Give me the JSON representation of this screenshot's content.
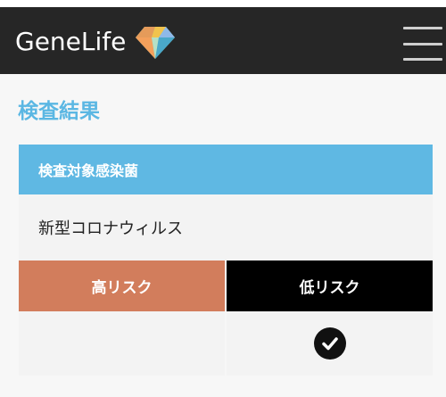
{
  "header": {
    "logo_text": "GeneLife",
    "logo_icon": "diamond-gem-icon",
    "menu_icon": "hamburger-menu-icon"
  },
  "page": {
    "title": "検査結果"
  },
  "table": {
    "header_label": "検査対象感染菌",
    "value": "新型コロナウィルス",
    "risk_high_label": "高リスク",
    "risk_low_label": "低リスク",
    "result": {
      "high": "",
      "low_icon": "check-circle-icon"
    }
  },
  "colors": {
    "header_bg": "#262626",
    "title": "#5bb7e3",
    "table_header_bg": "#5fb8e3",
    "risk_high_bg": "#d27d5c",
    "risk_low_bg": "#000000"
  }
}
